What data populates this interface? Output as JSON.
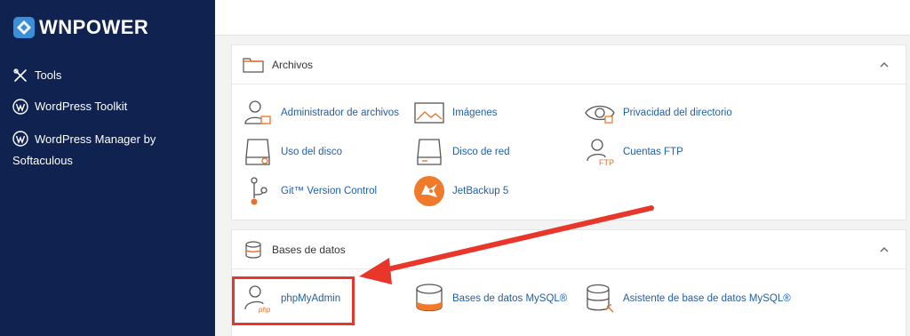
{
  "brand": {
    "logo_text": "WNPOWER"
  },
  "sidebar": {
    "items": [
      {
        "label": "Tools"
      },
      {
        "label": "WordPress Toolkit"
      },
      {
        "label": "WordPress Manager by Softaculous"
      }
    ]
  },
  "sections": [
    {
      "title": "Archivos",
      "items": [
        {
          "label": "Administrador de archivos"
        },
        {
          "label": "Imágenes"
        },
        {
          "label": "Privacidad del directorio"
        },
        {
          "label": "Uso del disco"
        },
        {
          "label": "Disco de red"
        },
        {
          "label": "Cuentas FTP"
        },
        {
          "label": "Git™ Version Control"
        },
        {
          "label": "JetBackup 5"
        }
      ]
    },
    {
      "title": "Bases de datos",
      "items": [
        {
          "label": "phpMyAdmin"
        },
        {
          "label": "Bases de datos MySQL®"
        },
        {
          "label": "Asistente de base de datos MySQL®"
        }
      ]
    }
  ],
  "icon_badges": {
    "php": "php",
    "ftp": "FTP"
  },
  "colors": {
    "sidebar_bg": "#0f2250",
    "link": "#1f5fa8",
    "accent_orange": "#e8702a",
    "annotation_red": "#e8372a"
  }
}
